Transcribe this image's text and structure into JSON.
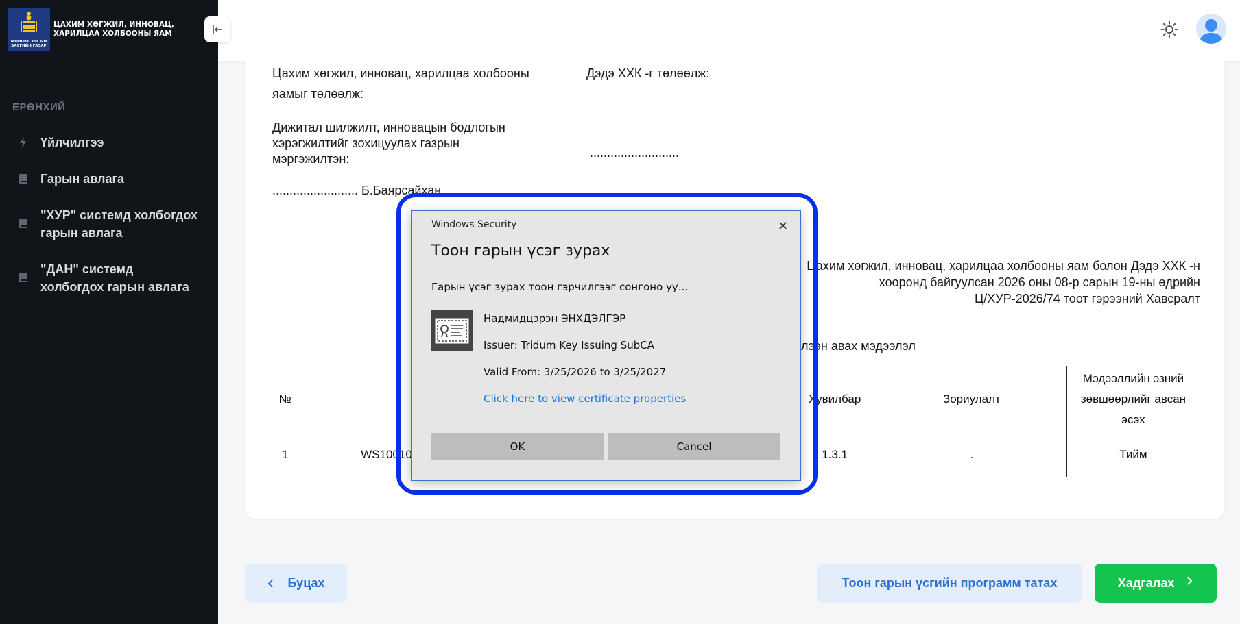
{
  "sidebar": {
    "logo_text": "МОНГОЛ УЛСЫН ЗАСГИЙН ГАЗАР",
    "org_name": "ЦАХИМ ХӨГЖИЛ, ИННОВАЦ, ХАРИЛЦАА ХОЛБООНЫ ЯАМ",
    "section": "ЕРӨНХИЙ",
    "items": [
      {
        "label": "Үйлчилгээ",
        "icon": "lightning-icon"
      },
      {
        "label": "Гарын авлага",
        "icon": "book-icon"
      },
      {
        "label": "\"ХУР\" системд холбогдох гарын авлага",
        "icon": "book-icon"
      },
      {
        "label": "\"ДАН\" системд холбогдох гарын авлага",
        "icon": "book-icon"
      }
    ]
  },
  "header": {
    "theme_icon": "sun-icon",
    "avatar_icon": "user-avatar-icon"
  },
  "document": {
    "left_party_1": "Цахим хөгжил, инновац, харилцаа холбооны",
    "left_party_2": "яамыг төлөөлж:",
    "left_role_1": "Дижитал шилжилт, инновацын бодлогын",
    "left_role_2": "хэрэгжилтийг зохицуулах газрын",
    "left_role_3": "мэргэжилтэн:",
    "left_signature": "......................... Б.Баярсайхан",
    "right_party": "Дэдэ ХХК -г төлөөлж:",
    "right_signature": "..........................",
    "annex_1": "Цахим хөгжил, инновац, харилцаа холбооны яам болон Дэдэ ХХК -н",
    "annex_2": "хооронд байгуулсан 2026 оны 08-р сарын 19-ны өдрийн",
    "annex_3": "Ц/ХУР-2026/74 тоот гэрээний Хавсралт",
    "table_title": "Хүлээн авах мэдээлэл",
    "table": {
      "headers": [
        "№",
        "",
        "Хувилбар",
        "Зориулалт",
        "Мэдээллийн эзний зөвшөөрлийг авсан эсэх"
      ],
      "rows": [
        [
          "1",
          "WS10010",
          "1.3.1",
          ".",
          "Тийм"
        ]
      ]
    }
  },
  "buttons": {
    "back": "Буцах",
    "download": "Тоон гарын үсгийн программ татах",
    "save": "Хадгалах"
  },
  "dialog": {
    "window_title": "Windows Security",
    "heading": "Тоон гарын үсэг зурах",
    "prompt": "Гарын үсэг зурах тоон гэрчилгээг сонгоно уу...",
    "cert_name": "Надмидцэрэн ЭНХДЭЛГЭР",
    "cert_issuer": "Issuer: Tridum Key Issuing SubCA",
    "cert_valid": "Valid From: 3/25/2026 to 3/25/2027",
    "cert_link": "Click here to view certificate properties",
    "ok": "OK",
    "cancel": "Cancel"
  },
  "colors": {
    "sidebar_bg": "#111418",
    "accent_blue": "#2b6fd3",
    "save_green": "#14c44f",
    "highlight": "#0a2fe6"
  }
}
